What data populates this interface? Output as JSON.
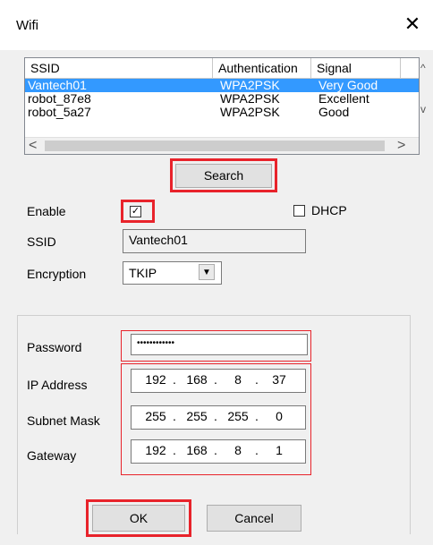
{
  "window": {
    "title": "Wifi",
    "close_glyph": "✕"
  },
  "networks": {
    "columns": [
      "SSID",
      "Authentication",
      "Signal"
    ],
    "rows": [
      {
        "ssid": "Vantech01",
        "auth": "WPA2PSK",
        "signal": "Very Good",
        "selected": true
      },
      {
        "ssid": "robot_87e8",
        "auth": "WPA2PSK",
        "signal": "Excellent",
        "selected": false
      },
      {
        "ssid": "robot_5a27",
        "auth": "WPA2PSK",
        "signal": "Good",
        "selected": false
      }
    ],
    "scroll_left": "<",
    "scroll_right": ">",
    "scroll_up": "^",
    "scroll_down": "v"
  },
  "search_label": "Search",
  "enable": {
    "label": "Enable",
    "checked": true,
    "mark": "✓"
  },
  "dhcp": {
    "label": "DHCP",
    "checked": false
  },
  "ssid": {
    "label": "SSID",
    "value": "Vantech01"
  },
  "encryption": {
    "label": "Encryption",
    "value": "TKIP",
    "arrow": "▼"
  },
  "password": {
    "label": "Password",
    "value": "••••••••••••"
  },
  "ip_address": {
    "label": "IP Address",
    "octets": [
      "192",
      "168",
      "8",
      "37"
    ]
  },
  "subnet_mask": {
    "label": "Subnet Mask",
    "octets": [
      "255",
      "255",
      "255",
      "0"
    ]
  },
  "gateway": {
    "label": "Gateway",
    "octets": [
      "192",
      "168",
      "8",
      "1"
    ]
  },
  "ok_label": "OK",
  "cancel_label": "Cancel",
  "colors": {
    "highlight": "#e8232b",
    "selection": "#3399ff"
  }
}
